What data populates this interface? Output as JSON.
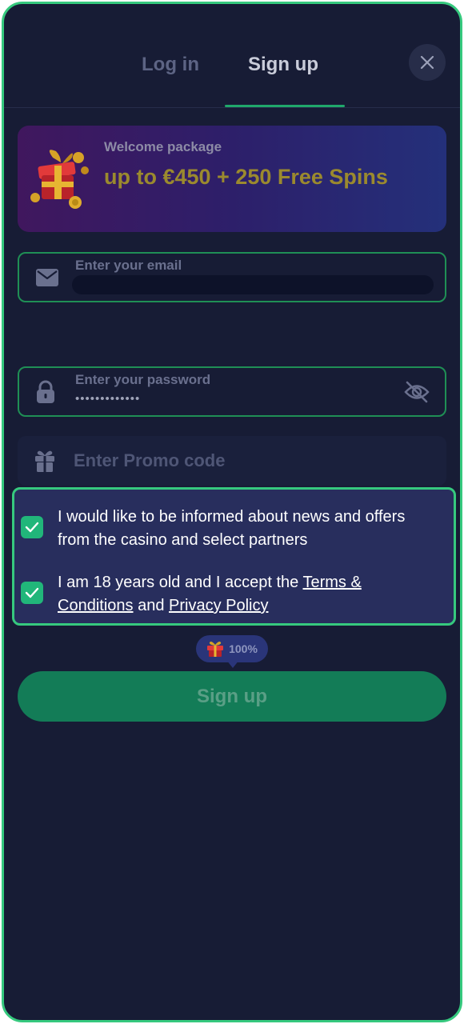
{
  "tabs": [
    {
      "label": "Log in",
      "active": false
    },
    {
      "label": "Sign up",
      "active": true
    }
  ],
  "banner": {
    "subtitle": "Welcome package",
    "title": "up to €450 + 250 Free Spins"
  },
  "form": {
    "email": {
      "label": "Enter your email",
      "value": ""
    },
    "password": {
      "label": "Enter your password",
      "value": "•••••••••••••"
    },
    "promo": {
      "placeholder": "Enter Promo code"
    }
  },
  "consents": {
    "news": {
      "text": "I would like to be informed about news and offers from the casino and select partners",
      "checked": true
    },
    "age": {
      "prefix": "I am 18 years old and I accept the ",
      "terms_link": "Terms & Conditions",
      "middle": " and ",
      "privacy_link": "Privacy Policy",
      "checked": true
    }
  },
  "bonus_badge": {
    "text": "100%"
  },
  "submit": {
    "label": "Sign up"
  },
  "icons": {
    "close": "close-icon",
    "gift_art": "gift-box-coins-icon",
    "email": "envelope-icon",
    "password": "lock-icon",
    "visibility": "eye-off-icon",
    "promo": "gift-icon",
    "check": "check-icon",
    "badge": "gift-icon"
  },
  "colors": {
    "background": "#171c35",
    "accent": "#36c97e",
    "button": "#137c57",
    "banner_title": "#9b8a2e"
  }
}
